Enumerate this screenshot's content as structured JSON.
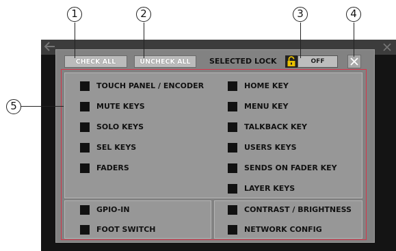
{
  "callouts": [
    "1",
    "2",
    "3",
    "4",
    "5"
  ],
  "toolbar": {
    "check_all_label": "CHECK ALL",
    "uncheck_all_label": "UNCHECK ALL",
    "selected_lock_label": "SELECTED LOCK",
    "selected_lock_state": "OFF",
    "close_icon": "close-icon",
    "lock_icon": "lock-icon"
  },
  "left_items": [
    {
      "label": "TOUCH PANEL / ENCODER",
      "checked": true
    },
    {
      "label": "MUTE KEYS",
      "checked": true
    },
    {
      "label": "SOLO KEYS",
      "checked": true
    },
    {
      "label": "SEL KEYS",
      "checked": true
    },
    {
      "label": "FADERS",
      "checked": true
    }
  ],
  "right_items": [
    {
      "label": "HOME KEY",
      "checked": true
    },
    {
      "label": "MENU KEY",
      "checked": true
    },
    {
      "label": "TALKBACK KEY",
      "checked": true
    },
    {
      "label": "USERS KEYS",
      "checked": true
    },
    {
      "label": "SENDS ON FADER KEY",
      "checked": true
    },
    {
      "label": "LAYER KEYS",
      "checked": true
    }
  ],
  "bottom_left_items": [
    {
      "label": "GPIO-IN",
      "checked": true
    },
    {
      "label": "FOOT SWITCH",
      "checked": true
    }
  ],
  "bottom_right_items": [
    {
      "label": "CONTRAST / BRIGHTNESS",
      "checked": true
    },
    {
      "label": "NETWORK CONFIG",
      "checked": true
    }
  ],
  "colors": {
    "dialog_bg": "#828282",
    "panel_bg": "#979797",
    "checkbox": "#111111",
    "highlight_border": "#d8344a"
  }
}
